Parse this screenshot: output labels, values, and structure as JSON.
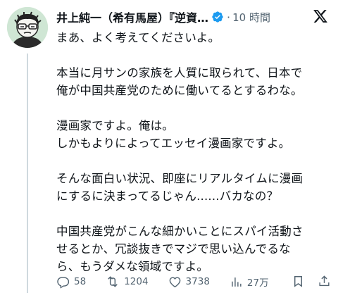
{
  "post": {
    "author_name": "井上純一（希有馬屋）『逆資…",
    "time_separator": "·",
    "time": "10 時間",
    "paragraphs": [
      [
        "まあ、よく考えてくださいよ。"
      ],
      [
        "本当に月サンの家族を人質に取られて、日本で",
        "俺が中国共産党のために働いてるとするわな。"
      ],
      [
        "漫画家ですよ。俺は。",
        "しかもよりによってエッセイ漫画家ですよ。"
      ],
      [
        "そんな面白い状況、即座にリアルタイムに漫画",
        "にするに決まってるじゃん......バカなの？"
      ],
      [
        "中国共産党がこんな細かいことにスパイ活動さ",
        "せるとか、冗談抜きでマジで思い込んでるな",
        "ら、もうダメな領域ですよ。"
      ]
    ]
  },
  "actions": {
    "replies": "58",
    "reposts": "1204",
    "likes": "3738",
    "views": "27万"
  },
  "colors": {
    "text": "#0f1419",
    "secondary": "#536471",
    "verified": "#1d9bf0",
    "thread_line": "#cfd9de"
  },
  "icons": [
    "avatar",
    "verified-badge-icon",
    "x-logo-icon",
    "reply-icon",
    "repost-icon",
    "like-icon",
    "views-icon",
    "bookmark-icon",
    "share-icon"
  ]
}
